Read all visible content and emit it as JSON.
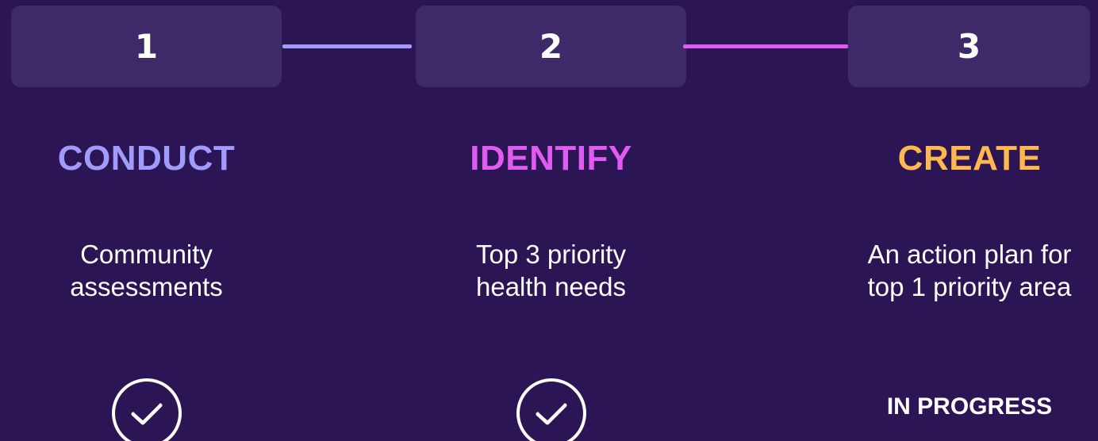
{
  "steps": [
    {
      "number": "1",
      "heading": "CONDUCT",
      "description": "Community\nassessments",
      "status_icon": "check-circle-icon",
      "heading_color": "#a19bfb"
    },
    {
      "number": "2",
      "heading": "IDENTIFY",
      "description": "Top 3 priority\nhealth needs",
      "status_icon": "check-circle-icon",
      "heading_color": "#e05cf0"
    },
    {
      "number": "3",
      "heading": "CREATE",
      "description": "An action plan for\ntop 1 priority area",
      "status_text": "IN PROGRESS",
      "heading_color": "#ffb84d"
    }
  ],
  "colors": {
    "background": "#2b1555",
    "box": "#3f2a69",
    "connector_1_2": "#a19bfb",
    "connector_2_3": "#e05cf0"
  }
}
